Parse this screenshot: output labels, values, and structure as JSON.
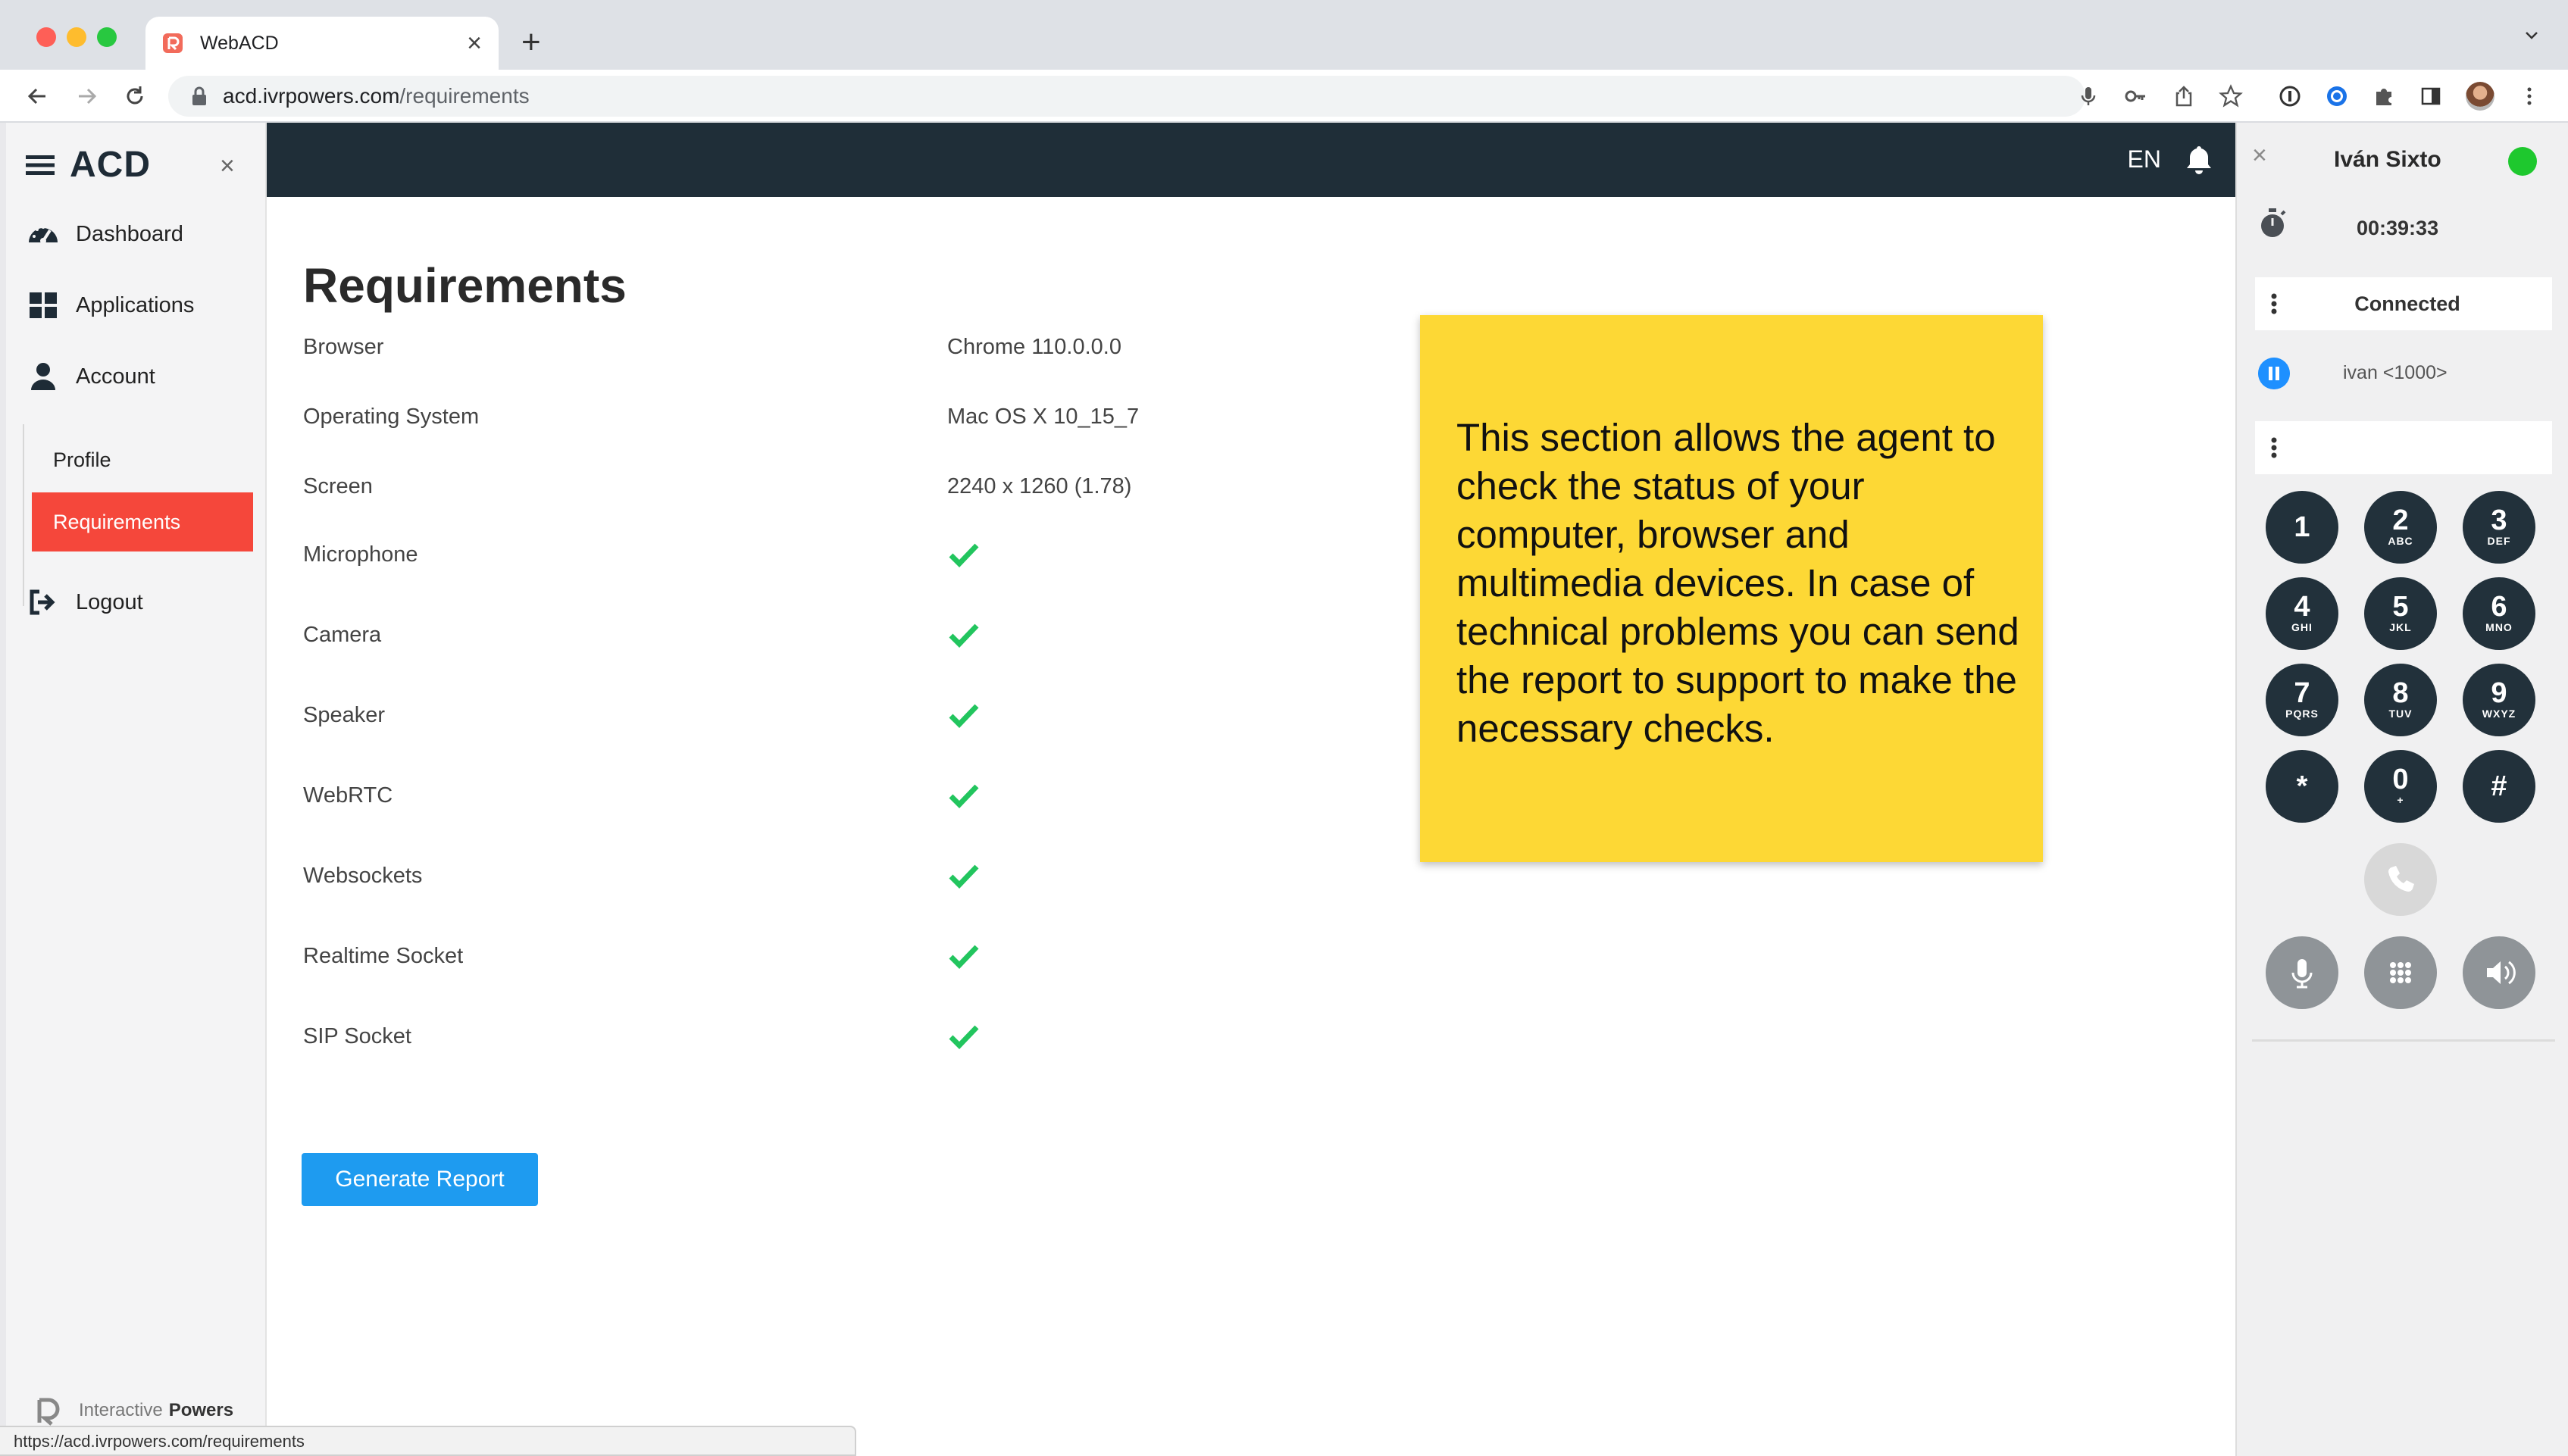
{
  "browser": {
    "tab_title": "WebACD",
    "url_host": "acd.ivrpowers.com",
    "url_path": "/requirements",
    "status_url": "https://acd.ivrpowers.com/requirements"
  },
  "sidebar": {
    "brand": "ACD",
    "items": [
      {
        "label": "Dashboard",
        "icon": "dashboard-icon"
      },
      {
        "label": "Applications",
        "icon": "grid-icon"
      },
      {
        "label": "Account",
        "icon": "user-icon"
      }
    ],
    "sub_items": [
      {
        "label": "Profile"
      },
      {
        "label": "Requirements",
        "active": true
      }
    ],
    "logout_label": "Logout",
    "footer_light": "Interactive",
    "footer_bold": "Powers"
  },
  "topbar": {
    "language": "EN"
  },
  "main": {
    "title": "Requirements",
    "rows": [
      {
        "label": "Browser",
        "value": "Chrome 110.0.0.0"
      },
      {
        "label": "Operating System",
        "value": "Mac OS X 10_15_7"
      },
      {
        "label": "Screen",
        "value": "2240 x 1260 (1.78)"
      },
      {
        "label": "Microphone",
        "status": "ok"
      },
      {
        "label": "Camera",
        "status": "ok"
      },
      {
        "label": "Speaker",
        "status": "ok"
      },
      {
        "label": "WebRTC",
        "status": "ok"
      },
      {
        "label": "Websockets",
        "status": "ok"
      },
      {
        "label": "Realtime Socket",
        "status": "ok"
      },
      {
        "label": "SIP Socket",
        "status": "ok"
      }
    ],
    "button_label": "Generate Report"
  },
  "note": {
    "text": "This section allows the agent to check the status of your computer, browser and multimedia devices. In case of technical problems you can send the report to support to make the necessary checks."
  },
  "softphone": {
    "agent_name": "Iván Sixto",
    "timer": "00:39:33",
    "call_status": "Connected",
    "extension": "ivan <1000>",
    "keys": [
      {
        "digit": "1",
        "letters": ""
      },
      {
        "digit": "2",
        "letters": "ABC"
      },
      {
        "digit": "3",
        "letters": "DEF"
      },
      {
        "digit": "4",
        "letters": "GHI"
      },
      {
        "digit": "5",
        "letters": "JKL"
      },
      {
        "digit": "6",
        "letters": "MNO"
      },
      {
        "digit": "7",
        "letters": "PQRS"
      },
      {
        "digit": "8",
        "letters": "TUV"
      },
      {
        "digit": "9",
        "letters": "WXYZ"
      },
      {
        "digit": "*",
        "letters": ""
      },
      {
        "digit": "0",
        "letters": "+"
      },
      {
        "digit": "#",
        "letters": ""
      }
    ]
  },
  "colors": {
    "topbar": "#1f2e38",
    "active_nav": "#f5473b",
    "primary_button": "#1e9bf0",
    "check": "#22c55e",
    "note": "#fdd835",
    "online": "#1ec82e"
  }
}
